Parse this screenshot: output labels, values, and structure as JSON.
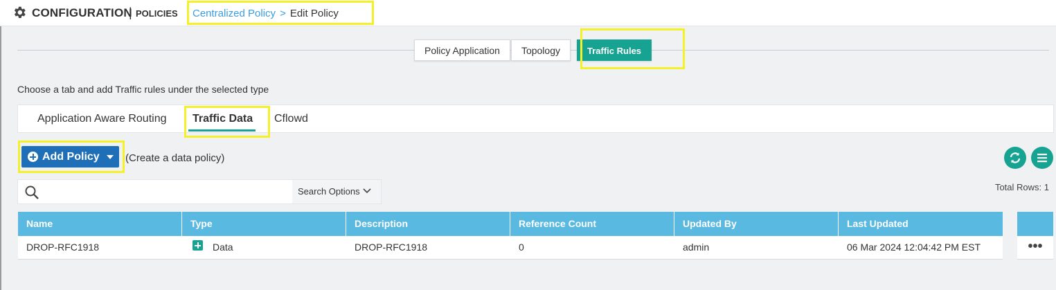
{
  "header": {
    "title": "CONFIGURATION",
    "separator": "|",
    "subtitle": "POLICIES",
    "breadcrumb": {
      "parent": "Centralized Policy",
      "separator": ">",
      "current": "Edit Policy"
    }
  },
  "top_tabs": [
    {
      "label": "Policy Application",
      "active": false
    },
    {
      "label": "Topology",
      "active": false
    },
    {
      "label": "Traffic Rules",
      "active": true
    }
  ],
  "hint": "Choose a tab and add Traffic rules under the selected type",
  "sub_tabs": [
    {
      "label": "Application Aware Routing",
      "active": false
    },
    {
      "label": "Traffic Data",
      "active": true
    },
    {
      "label": "Cflowd",
      "active": false
    }
  ],
  "toolbar": {
    "add_label": "Add Policy",
    "add_hint": "(Create a data policy)",
    "search_placeholder": "",
    "search_options_label": "Search Options",
    "total_rows": "Total Rows: 1"
  },
  "table": {
    "columns": [
      "Name",
      "Type",
      "Description",
      "Reference Count",
      "Updated By",
      "Last Updated"
    ],
    "rows": [
      {
        "name": "DROP-RFC1918",
        "type": "Data",
        "description": "DROP-RFC1918",
        "reference_count": "0",
        "updated_by": "admin",
        "last_updated": "06 Mar 2024 12:04:42 PM EST",
        "actions": "•••"
      }
    ]
  },
  "colors": {
    "accent_teal": "#17a392",
    "primary_blue": "#1f6fb8",
    "table_header": "#5ab9e0",
    "link": "#3c9ce0",
    "highlight": "#f4f12a"
  },
  "icons": {
    "header": "gear-icon",
    "add": "plus-circle-icon",
    "refresh": "refresh-icon",
    "menu": "hamburger-menu-icon",
    "search": "search-icon",
    "type_data": "data-plus-icon",
    "row_actions": "more-icon"
  }
}
